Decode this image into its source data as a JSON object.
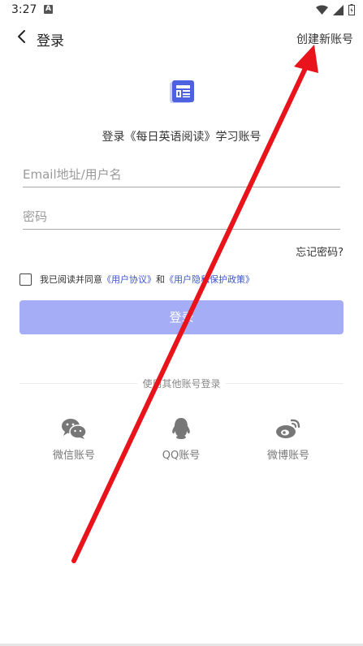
{
  "status_bar": {
    "time": "3:27",
    "notif_letter": "A"
  },
  "nav": {
    "title": "登录",
    "create_account": "创建新账号"
  },
  "login_heading": "登录《每日英语阅读》学习账号",
  "form": {
    "email_placeholder": "Email地址/用户名",
    "password_placeholder": "密码",
    "forgot": "忘记密码?"
  },
  "agreement": {
    "prefix": "我已阅读并同意",
    "user_agreement": "《用户协议》",
    "and": "和",
    "privacy_policy": "《用户隐私保护政策》",
    "checked": false
  },
  "login_button": "登录",
  "other_login": {
    "label": "使用其他账号登录",
    "options": [
      {
        "label": "微信账号",
        "icon": "wechat-icon"
      },
      {
        "label": "QQ账号",
        "icon": "qq-icon"
      },
      {
        "label": "微博账号",
        "icon": "weibo-icon"
      }
    ]
  },
  "colors": {
    "accent": "#3d55c8",
    "login_button_bg": "#a4adf6",
    "annotation_arrow": "#e8131b"
  }
}
